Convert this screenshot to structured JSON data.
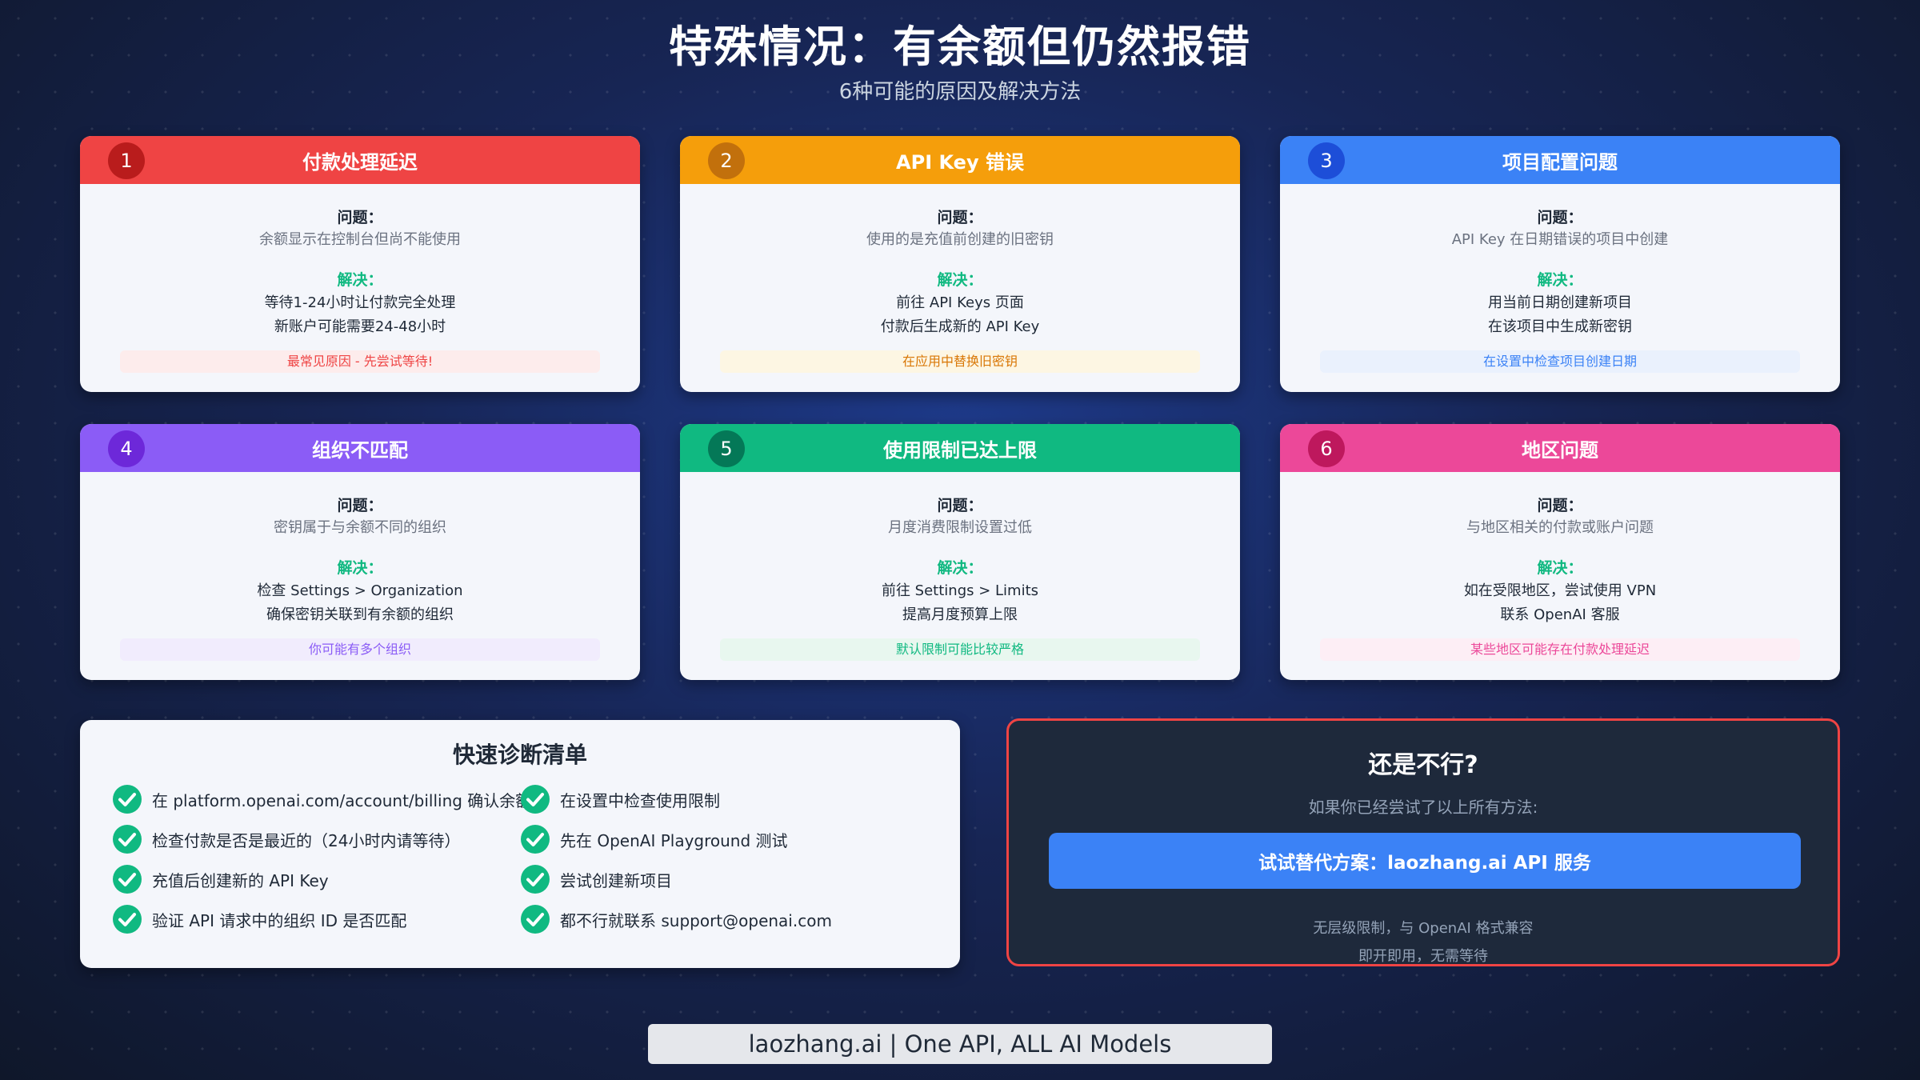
{
  "title": "特殊情况：有余额但仍然报错",
  "subtitle": "6种可能的原因及解决方法",
  "labels": {
    "problem": "问题：",
    "solution": "解决："
  },
  "cards": [
    {
      "num": "1",
      "title": "付款处理延迟",
      "color": "#ef4444",
      "num_color": "#b91c1c",
      "problem": "余额显示在控制台但尚不能使用",
      "solution": [
        "等待1-24小时让付款完全处理",
        "新账户可能需要24-48小时"
      ],
      "tip": "最常见原因 - 先尝试等待!",
      "tip_color": "#ef4444",
      "tip_bg": "#fdecec"
    },
    {
      "num": "2",
      "title": "API Key 错误",
      "color": "#f59e0b",
      "num_color": "#c2700c",
      "problem": "使用的是充值前创建的旧密钥",
      "solution": [
        "前往 API Keys 页面",
        "付款后生成新的 API Key"
      ],
      "tip": "在应用中替换旧密钥",
      "tip_color": "#d97706",
      "tip_bg": "#fdf6e3"
    },
    {
      "num": "3",
      "title": "项目配置问题",
      "color": "#3b82f6",
      "num_color": "#1d4ed8",
      "problem": "API Key 在日期错误的项目中创建",
      "solution": [
        "用当前日期创建新项目",
        "在该项目中生成新密钥"
      ],
      "tip": "在设置中检查项目创建日期",
      "tip_color": "#3b82f6",
      "tip_bg": "#eaf1fd"
    },
    {
      "num": "4",
      "title": "组织不匹配",
      "color": "#8b5cf6",
      "num_color": "#6d28d9",
      "problem": "密钥属于与余额不同的组织",
      "solution": [
        "检查 Settings > Organization",
        "确保密钥关联到有余额的组织"
      ],
      "tip": "你可能有多个组织",
      "tip_color": "#8b5cf6",
      "tip_bg": "#f1ecfd"
    },
    {
      "num": "5",
      "title": "使用限制已达上限",
      "color": "#10b981",
      "num_color": "#047857",
      "problem": "月度消费限制设置过低",
      "solution": [
        "前往 Settings > Limits",
        "提高月度预算上限"
      ],
      "tip": "默认限制可能比较严格",
      "tip_color": "#10b981",
      "tip_bg": "#e8f7ef"
    },
    {
      "num": "6",
      "title": "地区问题",
      "color": "#ec4899",
      "num_color": "#be185d",
      "problem": "与地区相关的付款或账户问题",
      "solution": [
        "如在受限地区，尝试使用 VPN",
        "联系 OpenAI 客服"
      ],
      "tip": "某些地区可能存在付款处理延迟",
      "tip_color": "#ec4899",
      "tip_bg": "#fdeef5"
    }
  ],
  "checklist": {
    "title": "快速诊断清单",
    "check_color": "#10b981",
    "items": [
      "在 platform.openai.com/account/billing 确认余额",
      "检查付款是否是最近的（24小时内请等待）",
      "充值后创建新的 API Key",
      "验证 API 请求中的组织 ID 是否匹配",
      "在设置中检查使用限制",
      "先在 OpenAI Playground 测试",
      "尝试创建新项目",
      "都不行就联系 support@openai.com"
    ]
  },
  "help": {
    "title": "还是不行?",
    "subtitle": "如果你已经尝试了以上所有方法:",
    "button": "试试替代方案：laozhang.ai API 服务",
    "notes": [
      "无层级限制，与 OpenAI 格式兼容",
      "即开即用，无需等待"
    ]
  },
  "footer": "laozhang.ai | One API, ALL AI Models"
}
